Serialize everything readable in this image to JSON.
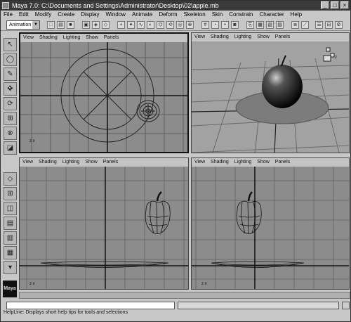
{
  "window": {
    "title": "Maya 7.0: C:\\Documents and Settings\\Administrator\\Desktop\\02\\apple.mb"
  },
  "menus": [
    "File",
    "Edit",
    "Modify",
    "Create",
    "Display",
    "Window",
    "Animate",
    "Deform",
    "Skeleton",
    "Skin",
    "Constrain",
    "Character",
    "Help"
  ],
  "toolbar": {
    "mode": "Animation"
  },
  "panel_menu": [
    "View",
    "Shading",
    "Lighting",
    "Show",
    "Panels"
  ],
  "axis_labels": {
    "top": "z x",
    "persp": "y z x",
    "front": "z x",
    "side": "z x"
  },
  "helpline": {
    "text": "HelpLine: Displays short help tips for tools and selections"
  },
  "logo": {
    "text": "Maya"
  }
}
